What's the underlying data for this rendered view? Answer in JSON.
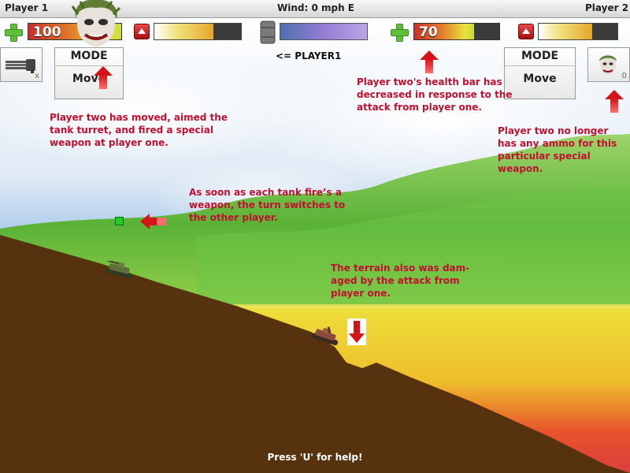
{
  "topbar": {
    "player1_label": "Player 1",
    "wind_label": "Wind: 0 mph E",
    "player2_label": "Player 2"
  },
  "player1": {
    "health": "100",
    "health_fraction": 1.0,
    "power_fraction": 0.68,
    "weapon_ammo": "x",
    "weapon_icon": "gatling-gun-icon",
    "mode_title": "MODE",
    "mode_value": "Move"
  },
  "player2": {
    "health": "70",
    "health_fraction": 0.7,
    "power_fraction": 0.68,
    "weapon_ammo": "0",
    "weapon_icon": "joker-face-icon",
    "mode_title": "MODE",
    "mode_value": "Move"
  },
  "turn_indicator": "<= PLAYER1",
  "annotations": {
    "player_two_action": "Player two has moved, aimed the tank turret, and fired a special weapon at player one.",
    "health_bar": "Player two's health bar has decreased in response to the attack from player one.",
    "ammo": "Player two no longer has any ammo for this particular special weapon.",
    "turn_switch": "As soon as each tank fire’s a weapon, the turn switches to the other player.",
    "terrain": "The terrain also was dam- aged by the attack from player one."
  },
  "help": "Press 'U' for help!",
  "colors": {
    "ground": "#57320e",
    "annotation_red": "#c2102f",
    "sky_blue": "#6f9fd8",
    "hill_green": "#5ab83a",
    "lava_red": "#e0402c",
    "target_green": "#22cc22"
  }
}
